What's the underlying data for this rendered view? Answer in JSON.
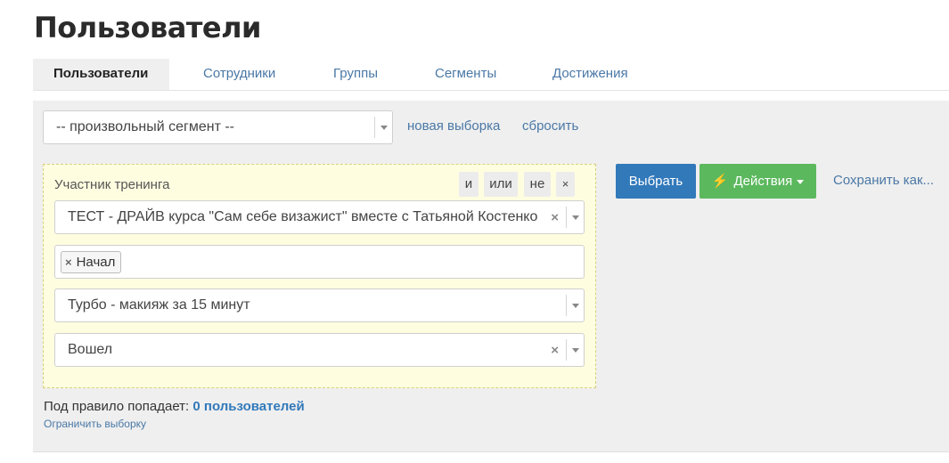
{
  "page": {
    "title": "Пользователи"
  },
  "tabs": [
    {
      "label": "Пользователи",
      "active": true
    },
    {
      "label": "Сотрудники",
      "active": false
    },
    {
      "label": "Группы",
      "active": false
    },
    {
      "label": "Сегменты",
      "active": false
    },
    {
      "label": "Достижения",
      "active": false
    }
  ],
  "segment": {
    "selected": "-- произвольный сегмент --",
    "new_selection_label": "новая выборка",
    "reset_label": "сбросить"
  },
  "rule": {
    "label": "Участник тренинга",
    "operators": {
      "and": "и",
      "or": "или",
      "not": "не",
      "remove": "×"
    },
    "training_select": "ТЕСТ - ДРАЙВ курса \"Сам себе визажист\" вместе с Татьяной Костенко",
    "status_tag": "Начал",
    "tag_remove": "×",
    "lesson_select": "Турбо - макияж за 15 минут",
    "action_select": "Вошел",
    "clear_symbol": "×"
  },
  "actions": {
    "select_label": "Выбрать",
    "actions_label": "Действия",
    "save_as_label": "Сохранить как..."
  },
  "summary": {
    "prefix": "Под правило попадает:",
    "count_text": "0 пользователей",
    "limit_link": "Ограничить выборку"
  },
  "colors": {
    "primary": "#3279ba",
    "success": "#5bb85d",
    "link": "#4a78a6",
    "rule_bg": "#fffde0",
    "panel_bg": "#efefef"
  }
}
